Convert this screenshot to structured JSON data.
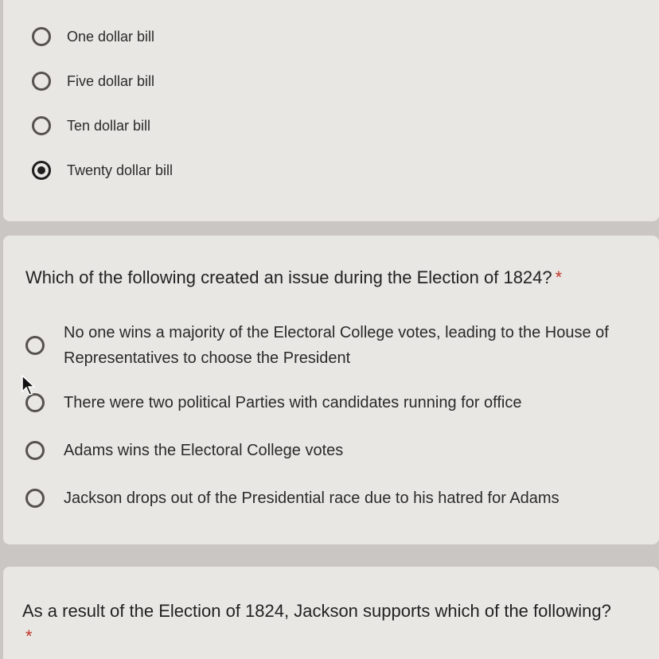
{
  "question1": {
    "options": [
      {
        "label": "One dollar bill",
        "selected": false
      },
      {
        "label": "Five dollar bill",
        "selected": false
      },
      {
        "label": "Ten dollar bill",
        "selected": false
      },
      {
        "label": "Twenty dollar bill",
        "selected": true
      }
    ]
  },
  "question2": {
    "title": "Which of the following created an issue during the Election of 1824?",
    "required_mark": "*",
    "options": [
      {
        "label": "No one wins a majority of the Electoral College votes, leading to the House of Representatives to choose the President",
        "selected": false
      },
      {
        "label": "There were two political Parties with candidates running for office",
        "selected": false
      },
      {
        "label": "Adams wins the Electoral College votes",
        "selected": false
      },
      {
        "label": "Jackson drops out of the Presidential race due to his hatred for Adams",
        "selected": false
      }
    ]
  },
  "question3": {
    "title": "As a result of the Election of 1824, Jackson supports which of the following?",
    "required_mark": "*"
  },
  "colors": {
    "background": "#c9c6c3",
    "card": "#e9e7e4",
    "required": "#c0392b"
  }
}
